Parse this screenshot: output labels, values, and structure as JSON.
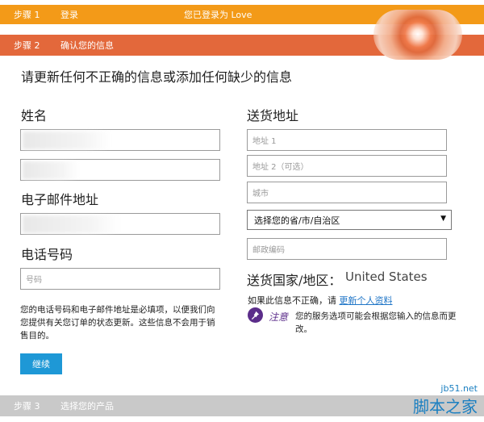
{
  "steps": [
    {
      "num": "步骤 1",
      "title": "登录",
      "status": "您已登录为 Love"
    },
    {
      "num": "步骤 2",
      "title": "确认您的信息"
    },
    {
      "num": "步骤 3",
      "title": "选择您的产品"
    }
  ],
  "heading": "请更新任何不正确的信息或添加任何缺少的信息",
  "left": {
    "name_label": "姓名",
    "email_label": "电子邮件地址",
    "phone_label": "电话号码",
    "phone_placeholder": "号码",
    "note": "您的电话号码和电子邮件地址是必填项，以便我们向您提供有关您订单的状态更新。这些信息不会用于销售目的。",
    "continue_button": "继续"
  },
  "right": {
    "address_label": "送货地址",
    "address1_placeholder": "地址 1",
    "address2_placeholder": "地址 2（可选）",
    "city_placeholder": "城市",
    "province_select": "选择您的省/市/自治区",
    "postal_placeholder": "邮政编码",
    "country_label": "送货国家/地区：",
    "country_value": "United States",
    "incorrect_text": "如果此信息不正确，请",
    "update_link": "更新个人资料",
    "notice_label": "注意",
    "notice_text": "您的服务选项可能会根据您输入的信息而更改。"
  },
  "watermark": {
    "site": "jb51.net",
    "name": "脚本之家"
  },
  "colors": {
    "step1": "#f39a18",
    "step2": "#e3683b",
    "step3": "#c9c9c9",
    "button": "#1e98d6",
    "link": "#2076c7",
    "notice": "#5b2d8a"
  }
}
